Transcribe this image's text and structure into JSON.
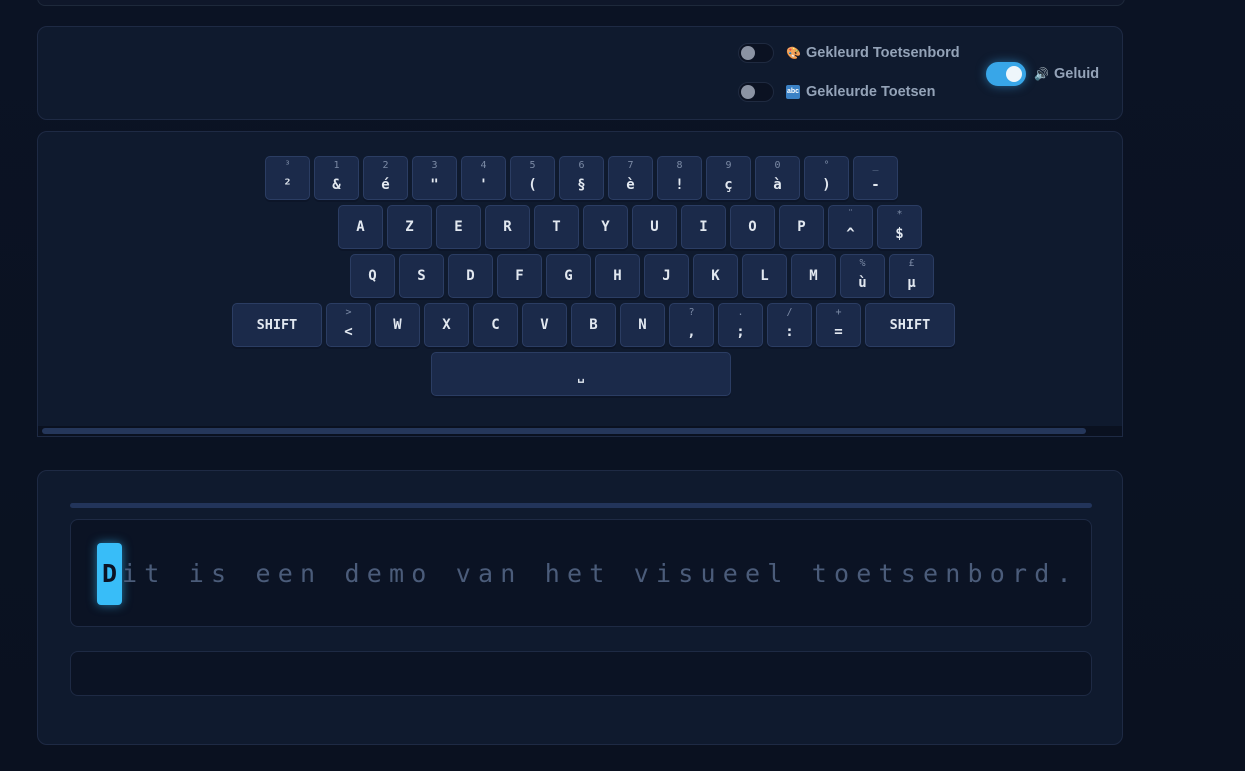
{
  "settings": {
    "colored_keyboard_label": "Gekleurd Toetsenbord",
    "colored_keyboard_on": false,
    "colored_keys_label": "Gekleurde Toetsen",
    "colored_keys_on": false,
    "sound_label": "Geluid",
    "sound_on": true,
    "icons": {
      "colored_keyboard": "palette-icon",
      "colored_keys": "abc-icon",
      "sound": "speaker-icon"
    }
  },
  "keyboard": {
    "layout": "AZERTY (Belgian)",
    "rows": [
      [
        {
          "main": "²",
          "sub": "³"
        },
        {
          "main": "&",
          "sub": "1"
        },
        {
          "main": "é",
          "sub": "2"
        },
        {
          "main": "\"",
          "sub": "3"
        },
        {
          "main": "'",
          "sub": "4"
        },
        {
          "main": "(",
          "sub": "5"
        },
        {
          "main": "§",
          "sub": "6"
        },
        {
          "main": "è",
          "sub": "7"
        },
        {
          "main": "!",
          "sub": "8"
        },
        {
          "main": "ç",
          "sub": "9"
        },
        {
          "main": "à",
          "sub": "0"
        },
        {
          "main": ")",
          "sub": "°"
        },
        {
          "main": "-",
          "sub": "_"
        }
      ],
      [
        {
          "main": "A"
        },
        {
          "main": "Z"
        },
        {
          "main": "E"
        },
        {
          "main": "R"
        },
        {
          "main": "T"
        },
        {
          "main": "Y"
        },
        {
          "main": "U"
        },
        {
          "main": "I"
        },
        {
          "main": "O"
        },
        {
          "main": "P"
        },
        {
          "main": "^",
          "sub": "¨"
        },
        {
          "main": "$",
          "sub": "*"
        }
      ],
      [
        {
          "main": "Q"
        },
        {
          "main": "S"
        },
        {
          "main": "D"
        },
        {
          "main": "F"
        },
        {
          "main": "G"
        },
        {
          "main": "H"
        },
        {
          "main": "J"
        },
        {
          "main": "K"
        },
        {
          "main": "L"
        },
        {
          "main": "M"
        },
        {
          "main": "ù",
          "sub": "%"
        },
        {
          "main": "µ",
          "sub": "£"
        }
      ],
      [
        {
          "main": "SHIFT",
          "wide": true
        },
        {
          "main": "<",
          "sub": ">"
        },
        {
          "main": "W"
        },
        {
          "main": "X"
        },
        {
          "main": "C"
        },
        {
          "main": "V"
        },
        {
          "main": "B"
        },
        {
          "main": "N"
        },
        {
          "main": ",",
          "sub": "?"
        },
        {
          "main": ";",
          "sub": "."
        },
        {
          "main": ":",
          "sub": "/"
        },
        {
          "main": "=",
          "sub": "+"
        },
        {
          "main": "SHIFT",
          "wide": true
        }
      ],
      [
        {
          "main": "␣",
          "space": true
        }
      ]
    ]
  },
  "typing": {
    "current_char": "D",
    "remaining_text": "it is een demo van het visueel toetsenbord.",
    "input_value": "",
    "input_placeholder": ""
  }
}
